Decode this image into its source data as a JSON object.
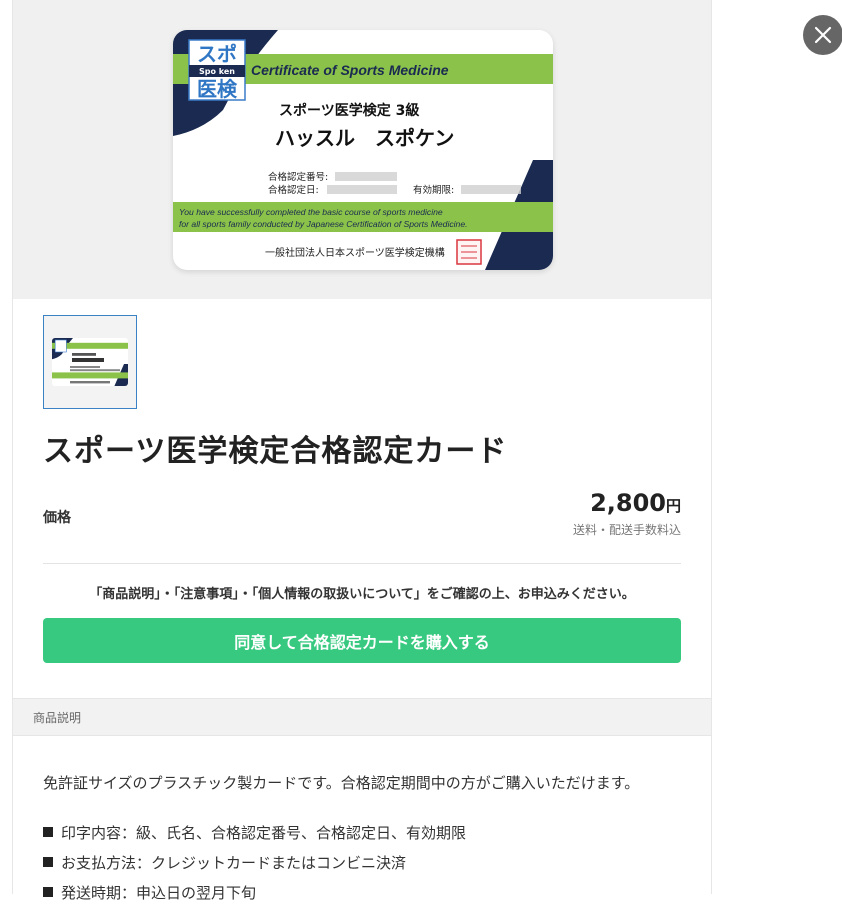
{
  "card": {
    "logo_top": "スポ",
    "logo_mid": "Spo ken",
    "logo_bottom": "医検",
    "banner": "Certificate of Sports Medicine",
    "grade": "スポーツ医学検定 3級",
    "name": "ハッスル　スポケン",
    "cert_no_label": "合格認定番号:",
    "cert_date_label": "合格認定日:",
    "expiry_label": "有効期限:",
    "message_line1": "You have successfully completed the basic course of sports medicine",
    "message_line2": "for all sports family conducted by Japanese Certification of Sports Medicine.",
    "issuer": "一般社団法人日本スポーツ医学検定機構",
    "colors": {
      "navy": "#1a2a50",
      "green": "#8bc34a",
      "seal": "#d9363e"
    }
  },
  "product": {
    "title": "スポーツ医学検定合格認定カード",
    "price_label": "価格",
    "price": "2,800",
    "currency": "円",
    "price_note": "送料・配送手数料込",
    "notice": "「商品説明」・「注意事項」・「個人情報の取扱いについて」をご確認の上、お申込みください。",
    "buy_button": "同意して合格認定カードを購入する"
  },
  "description": {
    "section_title": "商品説明",
    "intro": "免許証サイズのプラスチック製カードです。合格認定期間中の方がご購入いただけます。",
    "items": [
      "印字内容：級、氏名、合格認定番号、合格認定日、有効期限",
      "お支払方法：クレジットカードまたはコンビニ決済",
      "発送時期：申込日の翌月下旬"
    ]
  },
  "icons": {
    "close": "close-icon",
    "bullet": "square-bullet-icon"
  },
  "colors": {
    "buy_button": "#38c980",
    "close_button": "#666666"
  }
}
